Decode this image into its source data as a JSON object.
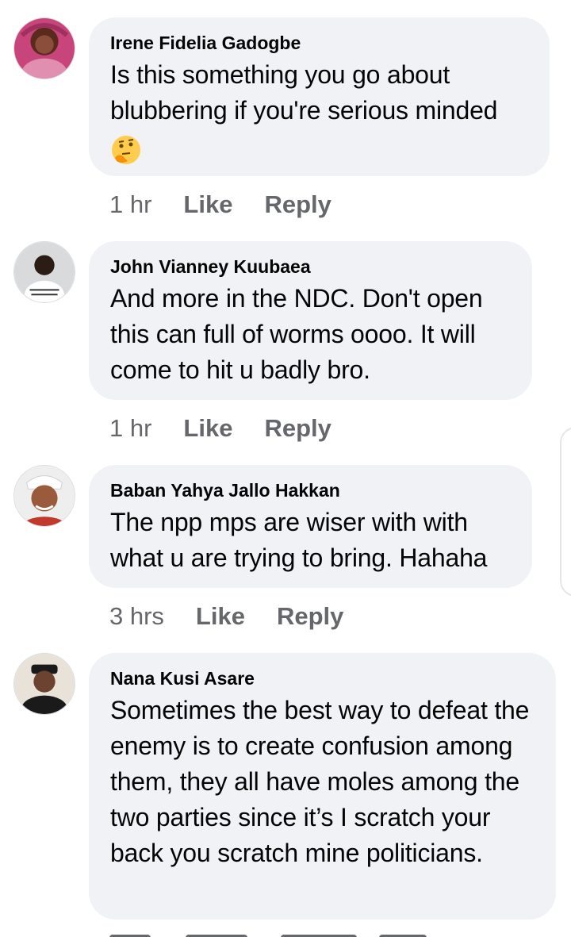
{
  "comments": [
    {
      "author": "Irene Fidelia Gadogbe",
      "text": "Is this something you go about blubbering if you're serious minded",
      "emoji": "thinking-face-emoji",
      "time": "1 hr",
      "like": "Like",
      "reply": "Reply"
    },
    {
      "author": "John Vianney Kuubaea",
      "text": "And more in the NDC. Don't open this can full of worms oooo. It will come to hit u badly bro.",
      "time": "1 hr",
      "like": "Like",
      "reply": "Reply"
    },
    {
      "author": "Baban Yahya Jallo Hakkan",
      "text": "The npp mps are wiser with with what u are trying to bring. Hahaha",
      "time": "3 hrs",
      "like": "Like",
      "reply": "Reply"
    },
    {
      "author": "Nana Kusi Asare",
      "text": "Sometimes the best way to defeat the enemy is to create confusion among them, they all have moles among the two parties since it’s I scratch your back you scratch mine politicians.",
      "time": "",
      "like": "",
      "reply": ""
    }
  ],
  "colors": {
    "bubble": "#f0f2f5",
    "meta": "#65676b",
    "text": "#050505"
  }
}
